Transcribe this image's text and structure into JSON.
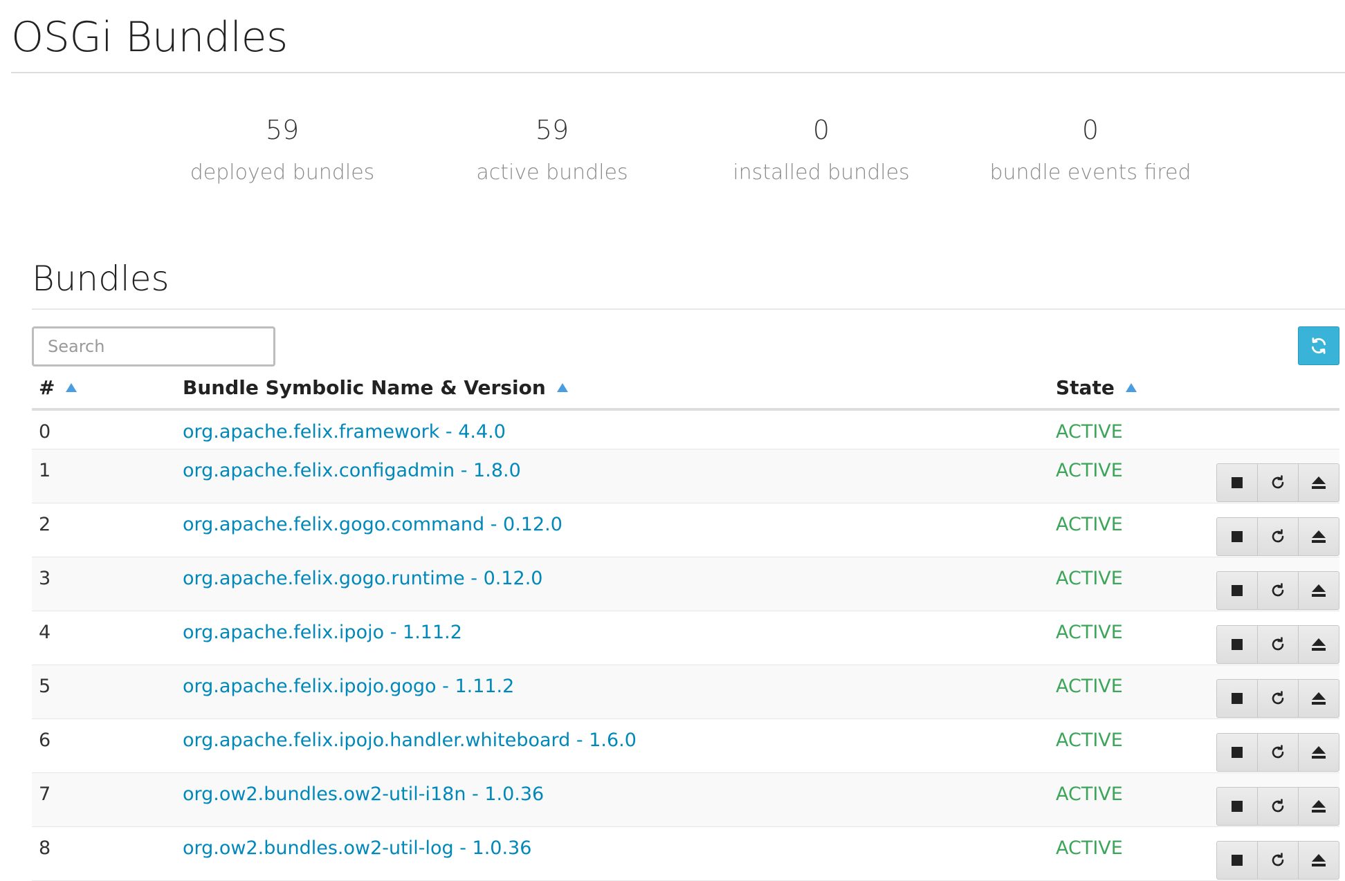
{
  "page": {
    "title": "OSGi Bundles"
  },
  "stats": [
    {
      "value": "59",
      "label": "deployed bundles"
    },
    {
      "value": "59",
      "label": "active bundles"
    },
    {
      "value": "0",
      "label": "installed bundles"
    },
    {
      "value": "0",
      "label": "bundle events fired"
    }
  ],
  "bundles_section": {
    "title": "Bundles",
    "search_placeholder": "Search",
    "refresh_icon": "refresh-icon",
    "columns": {
      "id": "#",
      "name": "Bundle Symbolic Name & Version",
      "state": "State"
    },
    "row_action_icons": [
      "stop-icon",
      "restart-icon",
      "uninstall-icon"
    ],
    "rows": [
      {
        "id": "0",
        "name": "org.apache.felix.framework - 4.4.0",
        "state": "ACTIVE",
        "has_actions": false
      },
      {
        "id": "1",
        "name": "org.apache.felix.configadmin - 1.8.0",
        "state": "ACTIVE",
        "has_actions": true
      },
      {
        "id": "2",
        "name": "org.apache.felix.gogo.command - 0.12.0",
        "state": "ACTIVE",
        "has_actions": true
      },
      {
        "id": "3",
        "name": "org.apache.felix.gogo.runtime - 0.12.0",
        "state": "ACTIVE",
        "has_actions": true
      },
      {
        "id": "4",
        "name": "org.apache.felix.ipojo - 1.11.2",
        "state": "ACTIVE",
        "has_actions": true
      },
      {
        "id": "5",
        "name": "org.apache.felix.ipojo.gogo - 1.11.2",
        "state": "ACTIVE",
        "has_actions": true
      },
      {
        "id": "6",
        "name": "org.apache.felix.ipojo.handler.whiteboard - 1.6.0",
        "state": "ACTIVE",
        "has_actions": true
      },
      {
        "id": "7",
        "name": "org.ow2.bundles.ow2-util-i18n - 1.0.36",
        "state": "ACTIVE",
        "has_actions": true
      },
      {
        "id": "8",
        "name": "org.ow2.bundles.ow2-util-log - 1.0.36",
        "state": "ACTIVE",
        "has_actions": true
      }
    ]
  },
  "colors": {
    "link": "#0088bb",
    "active_state": "#3da55a",
    "refresh_button": "#39b3d7",
    "sort_arrow": "#4a9de0"
  }
}
